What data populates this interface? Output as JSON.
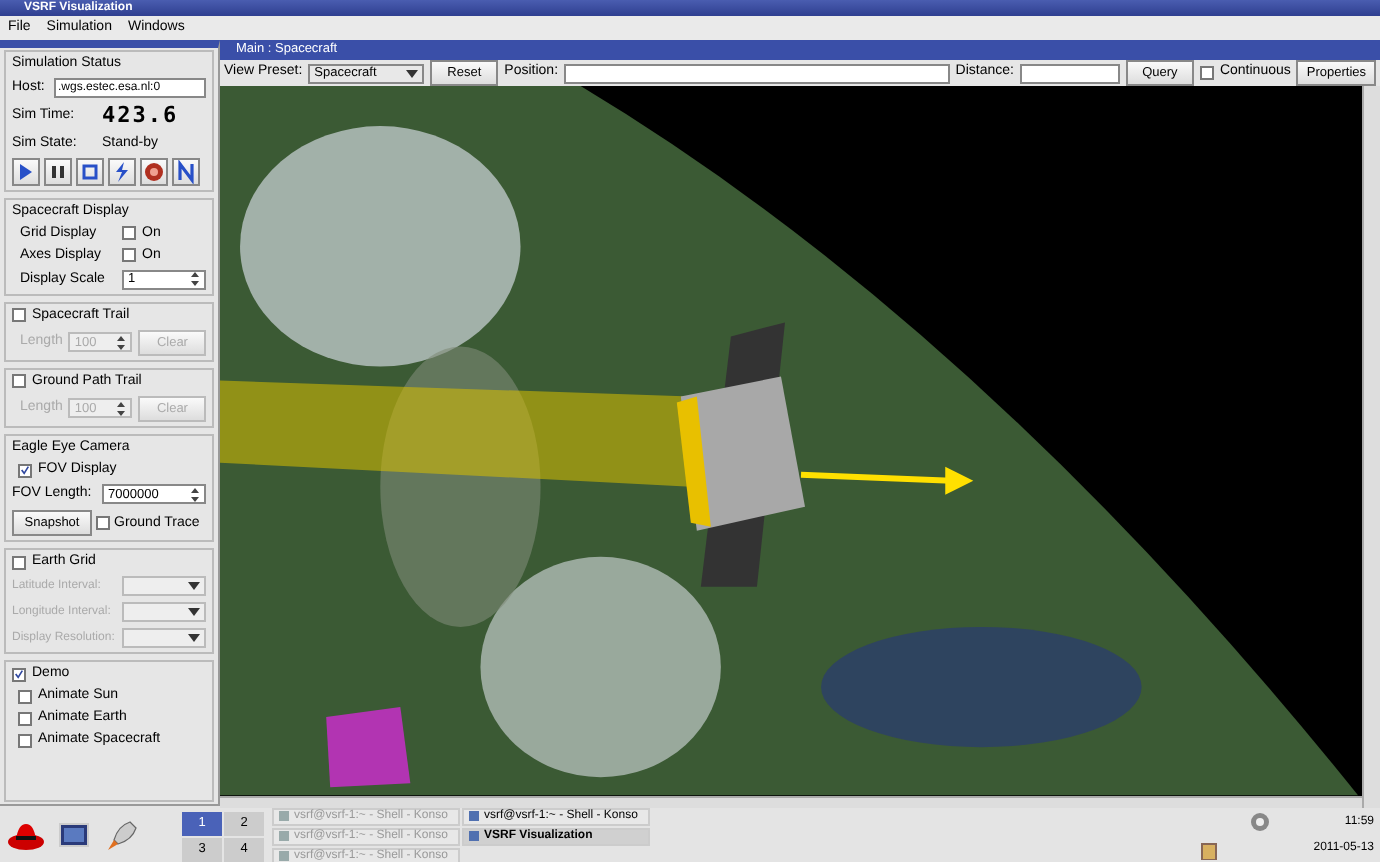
{
  "window": {
    "title": "VSRF Visualization"
  },
  "menu": [
    {
      "label": "File"
    },
    {
      "label": "Simulation"
    },
    {
      "label": "Windows"
    }
  ],
  "simulation_status": {
    "title": "Simulation Status",
    "host_label": "Host:",
    "host": ".wgs.estec.esa.nl:0",
    "time_label": "Sim Time:",
    "time": "423.6",
    "state_label": "Sim State:",
    "state": "Stand-by"
  },
  "spacecraft_display": {
    "title": "Spacecraft Display",
    "rows": [
      {
        "kind": "checkbox",
        "label": "Grid Display",
        "option": "On",
        "checked": false
      },
      {
        "kind": "checkbox",
        "label": "Axes Display",
        "option": "On",
        "checked": false
      },
      {
        "kind": "spin",
        "label": "Display Scale",
        "value": "1"
      }
    ]
  },
  "trails": [
    {
      "title": "Spacecraft Trail",
      "checked": false,
      "length_label": "Length",
      "length": "100",
      "button": "Clear"
    },
    {
      "title": "Ground Path Trail",
      "checked": false,
      "length_label": "Length",
      "length": "100",
      "button": "Clear"
    }
  ],
  "eagle_eye_camera": {
    "title": "Eagle Eye Camera",
    "fov_display": {
      "label": "FOV Display",
      "checked": true
    },
    "fov_length_label": "FOV Length:",
    "fov_length": "7000000",
    "snapshot": "Snapshot",
    "ground_trace": {
      "label": "Ground Trace",
      "checked": false
    }
  },
  "earth_grid": {
    "title": "Earth Grid",
    "checked": false,
    "fields": [
      {
        "label": "Latitude Interval:"
      },
      {
        "label": "Longitude Interval:"
      },
      {
        "label": "Display Resolution:"
      }
    ]
  },
  "demo": {
    "title": "Demo",
    "checked": true,
    "options": [
      {
        "label": "Animate Sun",
        "checked": false
      },
      {
        "label": "Animate Earth",
        "checked": false
      },
      {
        "label": "Animate Spacecraft",
        "checked": false
      }
    ]
  },
  "view_window": {
    "title": "Main : Spacecraft",
    "preset_label": "View Preset:",
    "preset": "Spacecraft",
    "reset": "Reset",
    "position_label": "Position:",
    "distance_label": "Distance:",
    "query": "Query",
    "continuous": {
      "label": "Continuous",
      "checked": false
    },
    "properties": "Properties"
  },
  "taskbar": {
    "desktops": [
      {
        "label": "1",
        "selected": true
      },
      {
        "label": "2",
        "selected": false
      },
      {
        "label": "3",
        "selected": false
      },
      {
        "label": "4",
        "selected": false
      }
    ],
    "tasks": [
      {
        "label": "vsrf@vsrf-1:~ - Shell - Konso",
        "selected": false,
        "dimmed": true
      },
      {
        "label": "vsrf@vsrf-1:~ - Shell - Konso",
        "selected": false,
        "dimmed": false
      },
      {
        "label": "vsrf@vsrf-1:~ - Shell - Konso",
        "selected": false,
        "dimmed": true
      },
      {
        "label": "VSRF Visualization",
        "selected": true,
        "dimmed": false
      },
      {
        "label": "vsrf@vsrf-1:~ - Shell - Konso",
        "selected": false,
        "dimmed": true
      }
    ],
    "clock": "11:59",
    "date": "2011-05-13"
  }
}
